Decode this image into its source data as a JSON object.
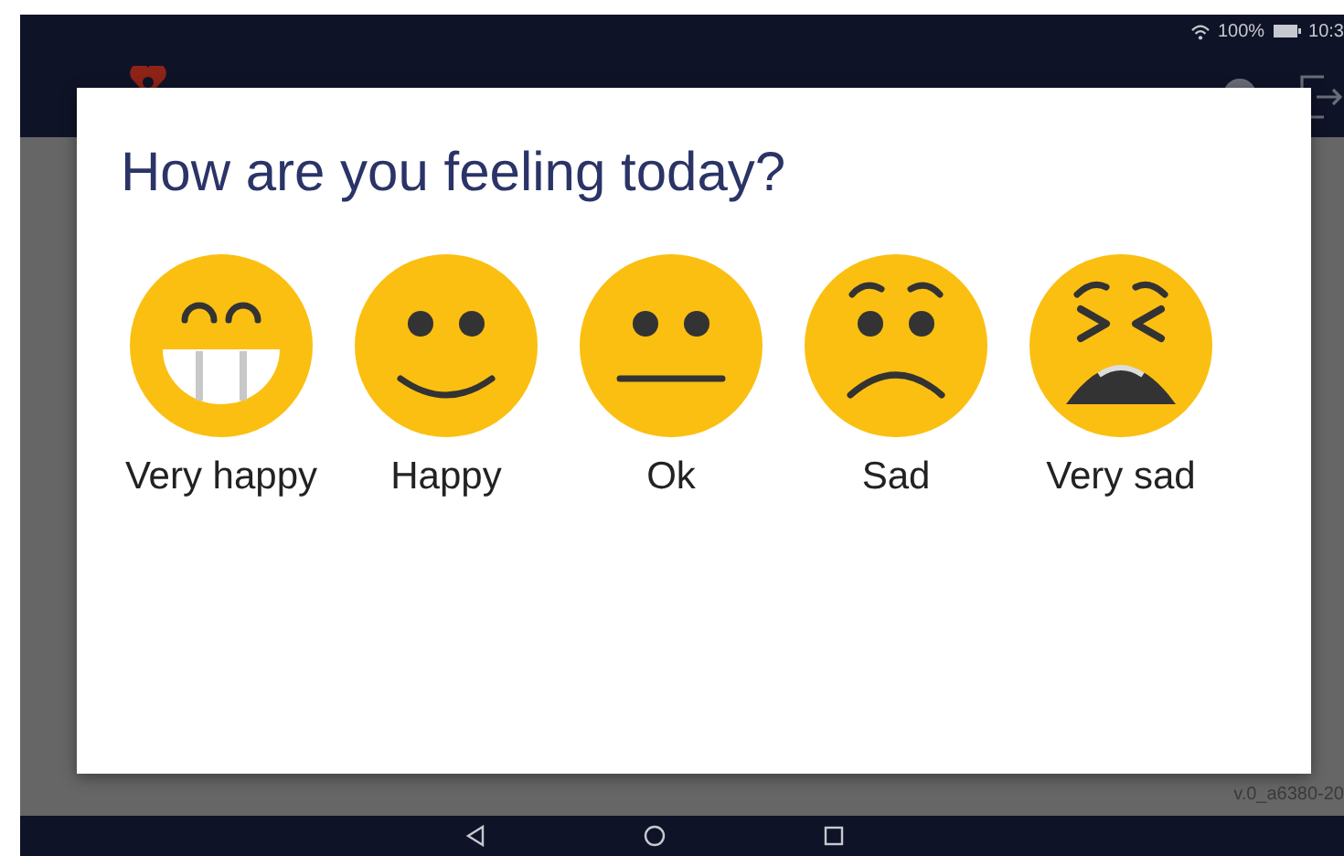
{
  "status_bar": {
    "battery": "100%",
    "time": "10:3"
  },
  "background": {
    "version": "v.0_a6380-20"
  },
  "dialog": {
    "title": "How are you feeling today?",
    "options": [
      {
        "kind": "very_happy",
        "label": "Very happy"
      },
      {
        "kind": "happy",
        "label": "Happy"
      },
      {
        "kind": "ok",
        "label": "Ok"
      },
      {
        "kind": "sad",
        "label": "Sad"
      },
      {
        "kind": "very_sad",
        "label": "Very sad"
      }
    ]
  }
}
